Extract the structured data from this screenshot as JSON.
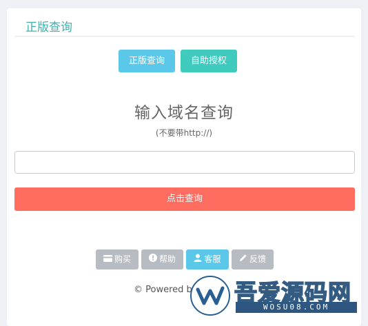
{
  "header": {
    "title": "正版查询"
  },
  "tabs": [
    {
      "label": "正版查询",
      "color": "#5bc8ea"
    },
    {
      "label": "自助授权",
      "color": "#40c9bd"
    }
  ],
  "main": {
    "title": "输入域名查询",
    "subtitle": "(不要带http://)",
    "input_value": "",
    "input_placeholder": "",
    "submit_label": "点击查询",
    "submit_color": "#fe6d5f"
  },
  "footer": {
    "buttons": [
      {
        "label": "购买",
        "icon": "credit-card-icon"
      },
      {
        "label": "帮助",
        "icon": "exclamation-circle-icon"
      },
      {
        "label": "客服",
        "icon": "user-icon"
      },
      {
        "label": "反馈",
        "icon": "pencil-icon"
      }
    ],
    "powered_text": "© Powered by"
  },
  "watermark": {
    "brand_text": "吾爱源码网",
    "url_text": "WOSU08.COM"
  }
}
